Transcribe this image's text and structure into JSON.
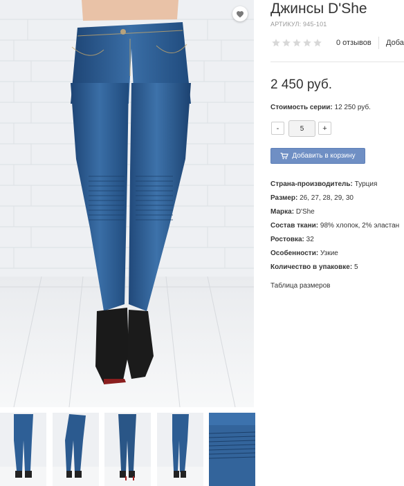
{
  "product": {
    "title": "Джинсы D'She",
    "sku_label": "АРТИКУЛ:",
    "sku_value": "945-101",
    "rating": 0,
    "reviews_label": "0 отзывов",
    "add_review_label": "Добавить отзыв",
    "price": "2 450 руб.",
    "series_label": "Стоимость серии:",
    "series_value": "12 250 руб."
  },
  "quantity": {
    "minus": "-",
    "value": "5",
    "plus": "+"
  },
  "cart_button": {
    "label": "Добавить в корзину",
    "icon": "cart-icon"
  },
  "specs": [
    {
      "label": "Страна-производитель:",
      "value": "Турция"
    },
    {
      "label": "Размер:",
      "value": "26, 27, 28, 29, 30"
    },
    {
      "label": "Марка:",
      "value": "D'She"
    },
    {
      "label": "Состав ткани:",
      "value": "98% хлопок, 2% эластан"
    },
    {
      "label": "Ростовка:",
      "value": "32"
    },
    {
      "label": "Особенности:",
      "value": "Узкие"
    },
    {
      "label": "Количество в упаковке:",
      "value": "5"
    }
  ],
  "size_table_link": "Таблица размеров",
  "gallery": {
    "wishlist_icon": "heart-icon",
    "thumbnail_count": 5
  },
  "colors": {
    "accent_button": "#6f8fc4",
    "denim": "#2b5b8f",
    "star_empty": "#d8d8d8"
  }
}
